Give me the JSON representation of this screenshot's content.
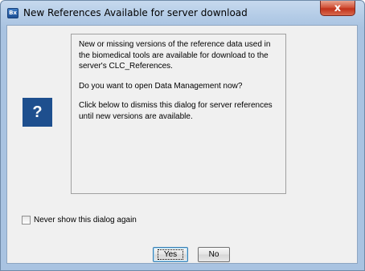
{
  "window": {
    "app_icon_text": "Bx",
    "title": "New References Available for server download",
    "close_symbol": "x"
  },
  "message": {
    "paragraphs": [
      "New or missing versions of the reference data used in the biomedical tools are available for download to the server's CLC_References.",
      "Do you want to open Data Management now?",
      "Click below to dismiss this dialog for server references until new versions are available."
    ],
    "icon_symbol": "?"
  },
  "checkbox": {
    "label": "Never show this dialog again",
    "checked": false
  },
  "buttons": {
    "yes": "Yes",
    "no": "No"
  },
  "colors": {
    "title_bar": "#b3cbe6",
    "question_icon_bg": "#1e4f8e",
    "close_button": "#c1321a",
    "client_bg": "#f0f0f0"
  }
}
